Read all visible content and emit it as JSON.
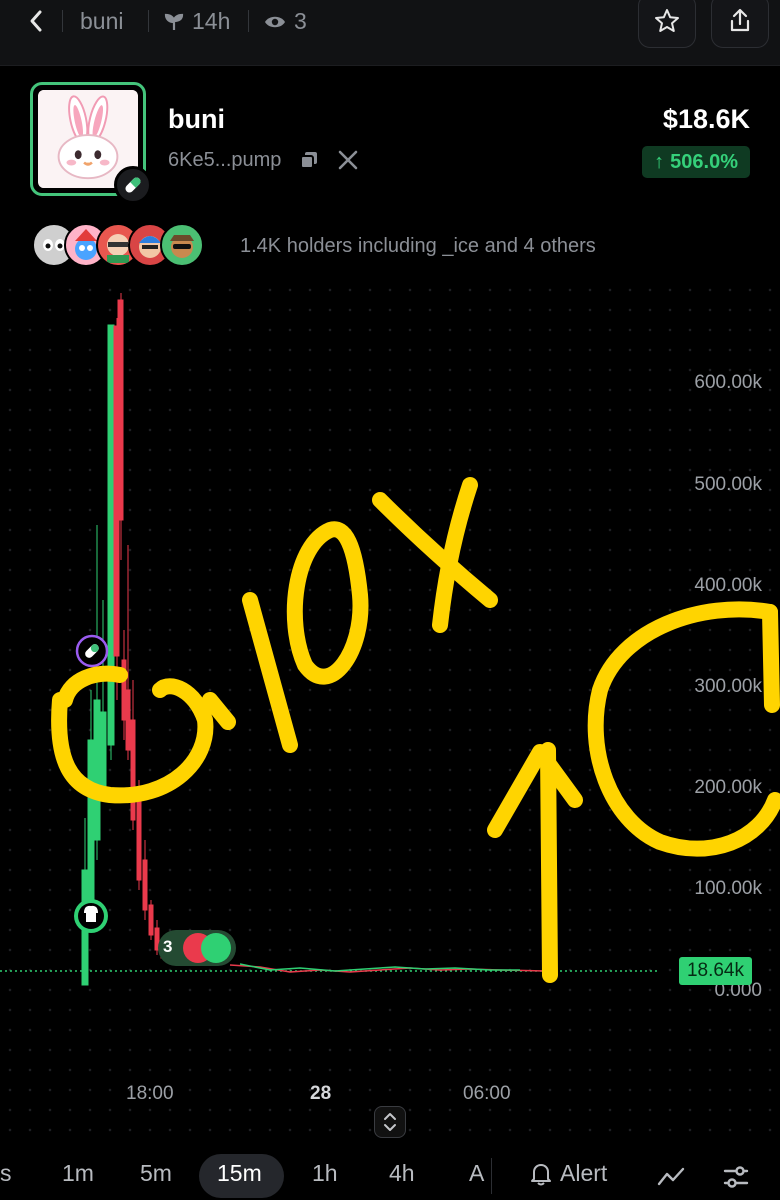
{
  "topbar": {
    "token_label": "buni",
    "age": "14h",
    "watchers": "3"
  },
  "token": {
    "name": "buni",
    "address": "6Ke5...pump",
    "market_cap": "$18.6K",
    "change": "506.0%",
    "change_color": "#35d07a"
  },
  "holders": {
    "text": "1.4K holders including _ice and 4 others",
    "avatar_colors": [
      "#d9d9d9",
      "#ff8fb1",
      "#e85d5d",
      "#d94545",
      "#4bbf73"
    ]
  },
  "chart": {
    "y_ticks": [
      "600.00k",
      "500.00k",
      "400.00k",
      "300.00k",
      "200.00k",
      "100.00k",
      "0.000"
    ],
    "x_ticks": [
      "18:00",
      "28",
      "06:00"
    ],
    "current_price": "18.64k",
    "trade_badge_count": "3",
    "annotation_text": "10X",
    "up_color": "#2fd073",
    "down_color": "#ea3a4c",
    "annotation_color": "#ffd400"
  },
  "toolbar": {
    "partial_left": "s",
    "timeframes": [
      "1m",
      "5m",
      "15m",
      "1h",
      "4h"
    ],
    "partial_right": "A",
    "active_timeframe": "15m",
    "alert_label": "Alert"
  }
}
